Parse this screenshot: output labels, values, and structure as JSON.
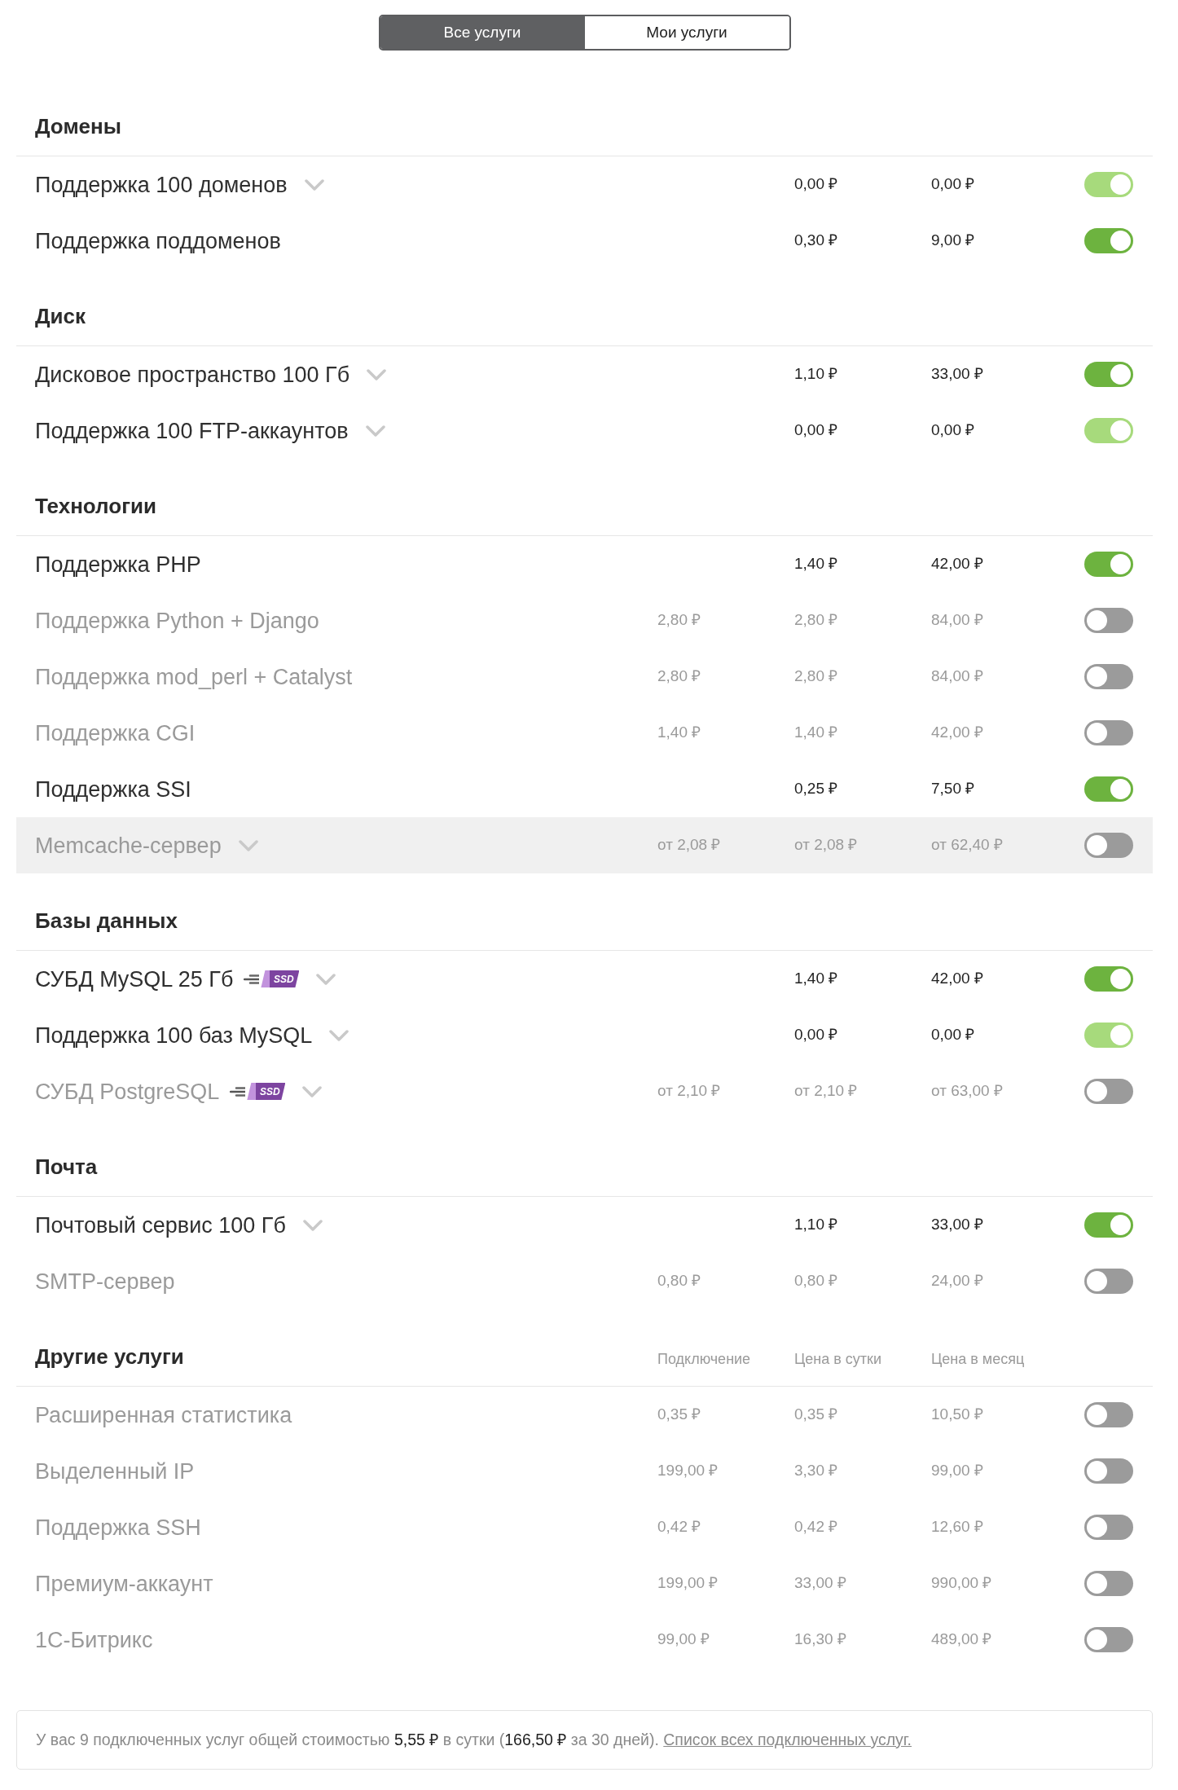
{
  "tabs": [
    {
      "label": "Все услуги",
      "selected": true
    },
    {
      "label": "Мои услуги",
      "selected": false
    }
  ],
  "sections": [
    {
      "title": "Домены",
      "rows": [
        {
          "name": "Поддержка 100 доменов",
          "expandable": true,
          "per_day": "0,00 ₽",
          "per_month": "0,00 ₽",
          "on": true,
          "disabled": true,
          "highlighted": false
        },
        {
          "name": "Поддержка поддоменов",
          "expandable": false,
          "per_day": "0,30 ₽",
          "per_month": "9,00 ₽",
          "on": true,
          "disabled": false,
          "highlighted": false
        }
      ]
    },
    {
      "title": "Диск",
      "rows": [
        {
          "name": "Дисковое пространство 100 Гб",
          "expandable": true,
          "per_day": "1,10 ₽",
          "per_month": "33,00 ₽",
          "on": true,
          "disabled": false,
          "highlighted": false
        },
        {
          "name": "Поддержка 100 FTP-аккаунтов",
          "expandable": true,
          "per_day": "0,00 ₽",
          "per_month": "0,00 ₽",
          "on": true,
          "disabled": true,
          "highlighted": false
        }
      ]
    },
    {
      "title": "Технологии",
      "rows": [
        {
          "name": "Поддержка PHP",
          "expandable": false,
          "per_day": "1,40 ₽",
          "per_month": "42,00 ₽",
          "on": true,
          "disabled": false,
          "highlighted": false
        },
        {
          "name": "Поддержка Python + Django",
          "expandable": false,
          "connection": "2,80 ₽",
          "per_day": "2,80 ₽",
          "per_month": "84,00 ₽",
          "on": false,
          "disabled": false,
          "highlighted": false
        },
        {
          "name": "Поддержка mod_perl + Catalyst",
          "expandable": false,
          "connection": "2,80 ₽",
          "per_day": "2,80 ₽",
          "per_month": "84,00 ₽",
          "on": false,
          "disabled": false,
          "highlighted": false
        },
        {
          "name": "Поддержка CGI",
          "expandable": false,
          "connection": "1,40 ₽",
          "per_day": "1,40 ₽",
          "per_month": "42,00 ₽",
          "on": false,
          "disabled": false,
          "highlighted": false
        },
        {
          "name": "Поддержка SSI",
          "expandable": false,
          "per_day": "0,25 ₽",
          "per_month": "7,50 ₽",
          "on": true,
          "disabled": false,
          "highlighted": false
        },
        {
          "name": "Memcache-сервер",
          "expandable": true,
          "connection": "от 2,08 ₽",
          "per_day": "от 2,08 ₽",
          "per_month": "от 62,40 ₽",
          "on": false,
          "disabled": false,
          "highlighted": true
        }
      ]
    },
    {
      "title": "Базы данных",
      "rows": [
        {
          "name": "СУБД MySQL 25 Гб",
          "badge": "SSD",
          "expandable": true,
          "per_day": "1,40 ₽",
          "per_month": "42,00 ₽",
          "on": true,
          "disabled": false,
          "highlighted": false
        },
        {
          "name": "Поддержка 100 баз MySQL",
          "expandable": true,
          "per_day": "0,00 ₽",
          "per_month": "0,00 ₽",
          "on": true,
          "disabled": true,
          "highlighted": false
        },
        {
          "name": "СУБД PostgreSQL",
          "badge": "SSD",
          "expandable": true,
          "connection": "от 2,10 ₽",
          "per_day": "от 2,10 ₽",
          "per_month": "от 63,00 ₽",
          "on": false,
          "disabled": false,
          "highlighted": false
        }
      ]
    },
    {
      "title": "Почта",
      "rows": [
        {
          "name": "Почтовый сервис 100 Гб",
          "expandable": true,
          "per_day": "1,10 ₽",
          "per_month": "33,00 ₽",
          "on": true,
          "disabled": false,
          "highlighted": false
        },
        {
          "name": "SMTP-сервер",
          "expandable": false,
          "connection": "0,80 ₽",
          "per_day": "0,80 ₽",
          "per_month": "24,00 ₽",
          "on": false,
          "disabled": false,
          "highlighted": false
        }
      ]
    },
    {
      "title": "Другие услуги",
      "columns": [
        "Подключение",
        "Цена в сутки",
        "Цена в месяц"
      ],
      "rows": [
        {
          "name": "Расширенная статистика",
          "expandable": false,
          "connection": "0,35 ₽",
          "per_day": "0,35 ₽",
          "per_month": "10,50 ₽",
          "on": false,
          "disabled": false,
          "highlighted": false
        },
        {
          "name": "Выделенный IP",
          "expandable": false,
          "connection": "199,00 ₽",
          "per_day": "3,30 ₽",
          "per_month": "99,00 ₽",
          "on": false,
          "disabled": false,
          "highlighted": false
        },
        {
          "name": "Поддержка SSH",
          "expandable": false,
          "connection": "0,42 ₽",
          "per_day": "0,42 ₽",
          "per_month": "12,60 ₽",
          "on": false,
          "disabled": false,
          "highlighted": false
        },
        {
          "name": "Премиум-аккаунт",
          "expandable": false,
          "connection": "199,00 ₽",
          "per_day": "33,00 ₽",
          "per_month": "990,00 ₽",
          "on": false,
          "disabled": false,
          "highlighted": false
        },
        {
          "name": "1С-Битрикс",
          "expandable": false,
          "connection": "99,00 ₽",
          "per_day": "16,30 ₽",
          "per_month": "489,00 ₽",
          "on": false,
          "disabled": false,
          "highlighted": false
        }
      ]
    }
  ],
  "summary": {
    "text": "У вас 9 подключенных услуг общей стоимостью **5,55 ₽** в сутки (**166,50 ₽** за 30 дней).",
    "link": "Список всех подключенных услуг."
  }
}
